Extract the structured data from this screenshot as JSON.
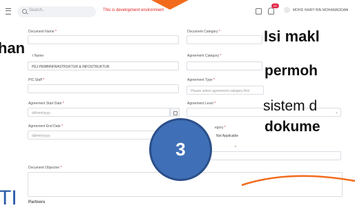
{
  "topbar": {
    "search_placeholder": "Search..",
    "environment_notice": "This is development environment",
    "notification_count": "99",
    "user_name": "MOHD HAIRY BIN MOHAMADDAH",
    "user_caret": "∨"
  },
  "form": {
    "document_name_label": "Document Name",
    "document_category_label": "Document Category",
    "unit_name_label": "t Name",
    "unit_name_value": "PEJ.PEMBINFRASTRUKTUR & INFOSTRUKTUR",
    "agreement_category_label": "Agreement Category",
    "pic_staff_label": "PIC Staff",
    "agreement_type_label": "Agreement Type",
    "agreement_type_placeholder": "Please select agreement category first",
    "agreement_start_label": "Agreement Start Date",
    "agreement_start_placeholder": "dd/mm/yyyy",
    "agreement_level_label": "Agreement Level",
    "agreement_end_label": "Agreement End Date",
    "agreement_end_placeholder": "dd/mm/yyyy",
    "category_label_partial": "egory",
    "not_applicable_label": "Not Applicable",
    "document_objective_label": "Document Objective",
    "partners_label": "Partners",
    "required_mark": "*"
  },
  "overlay": {
    "left_text": "han",
    "left_bottom": "TI",
    "right_line1": "Isi makl",
    "right_line2": "permoh",
    "right_line3": "sistem d",
    "right_line4": "dokume",
    "step_number": "3"
  },
  "colors": {
    "accent_orange": "#f26b1d",
    "step_circle": "#3f6fb6",
    "required_red": "#e02020"
  }
}
